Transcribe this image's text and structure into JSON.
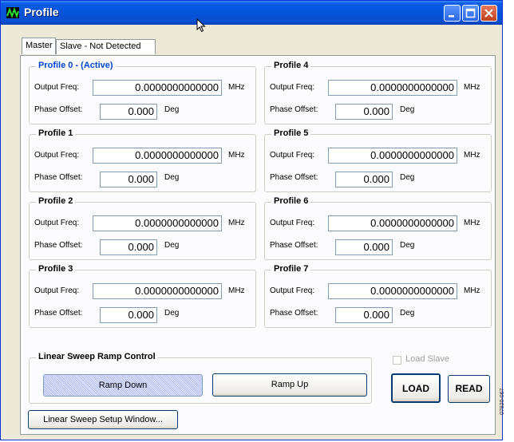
{
  "window": {
    "title": "Profile"
  },
  "tabs": [
    {
      "label": "Master",
      "active": true
    },
    {
      "label": "Slave - Not Detected",
      "active": false
    }
  ],
  "labels": {
    "output_freq": "Output Freq:",
    "phase_offset": "Phase Offset:",
    "freq_unit": "MHz",
    "phase_unit": "Deg"
  },
  "profiles": [
    {
      "title": "Profile 0 - (Active)",
      "active": true,
      "output_freq": "0.0000000000000",
      "phase_offset": "0.000"
    },
    {
      "title": "Profile 1",
      "active": false,
      "output_freq": "0.0000000000000",
      "phase_offset": "0.000"
    },
    {
      "title": "Profile 2",
      "active": false,
      "output_freq": "0.0000000000000",
      "phase_offset": "0.000"
    },
    {
      "title": "Profile 3",
      "active": false,
      "output_freq": "0.0000000000000",
      "phase_offset": "0.000"
    },
    {
      "title": "Profile 4",
      "active": false,
      "output_freq": "0.0000000000000",
      "phase_offset": "0.000"
    },
    {
      "title": "Profile 5",
      "active": false,
      "output_freq": "0.0000000000000",
      "phase_offset": "0.000"
    },
    {
      "title": "Profile 6",
      "active": false,
      "output_freq": "0.0000000000000",
      "phase_offset": "0.000"
    },
    {
      "title": "Profile 7",
      "active": false,
      "output_freq": "0.0000000000000",
      "phase_offset": "0.000"
    }
  ],
  "ramp": {
    "title": "Linear Sweep Ramp Control",
    "ramp_down": "Ramp Down",
    "ramp_up": "Ramp Up",
    "selected": "Ramp Down"
  },
  "actions": {
    "load_slave": "Load Slave",
    "load_slave_checked": false,
    "load": "LOAD",
    "read": "READ",
    "setup": "Linear Sweep Setup Window..."
  },
  "figure_number": "07920-067",
  "colors": {
    "titlebar": "#0553d8",
    "active_profile": "#0046d5",
    "window_bg": "#ece9d8"
  }
}
